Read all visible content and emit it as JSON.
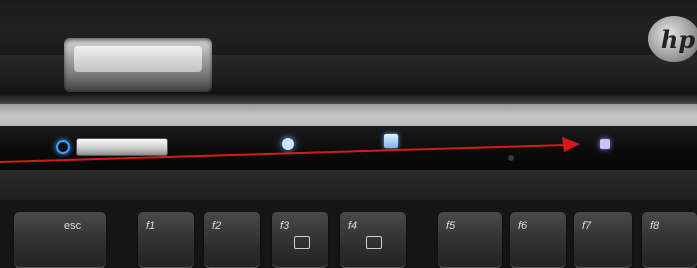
{
  "photo": {
    "brand_logo": "hp",
    "keys": [
      "esc",
      "f1",
      "f2",
      "f3",
      "f4",
      "f5",
      "f6",
      "f7",
      "f8"
    ],
    "indicators": {
      "power": "power-icon",
      "info": "info-icon",
      "presentation": "presentation-icon",
      "wireless": "wireless-icon"
    }
  },
  "annotation": {
    "color": "#d61a1a"
  }
}
